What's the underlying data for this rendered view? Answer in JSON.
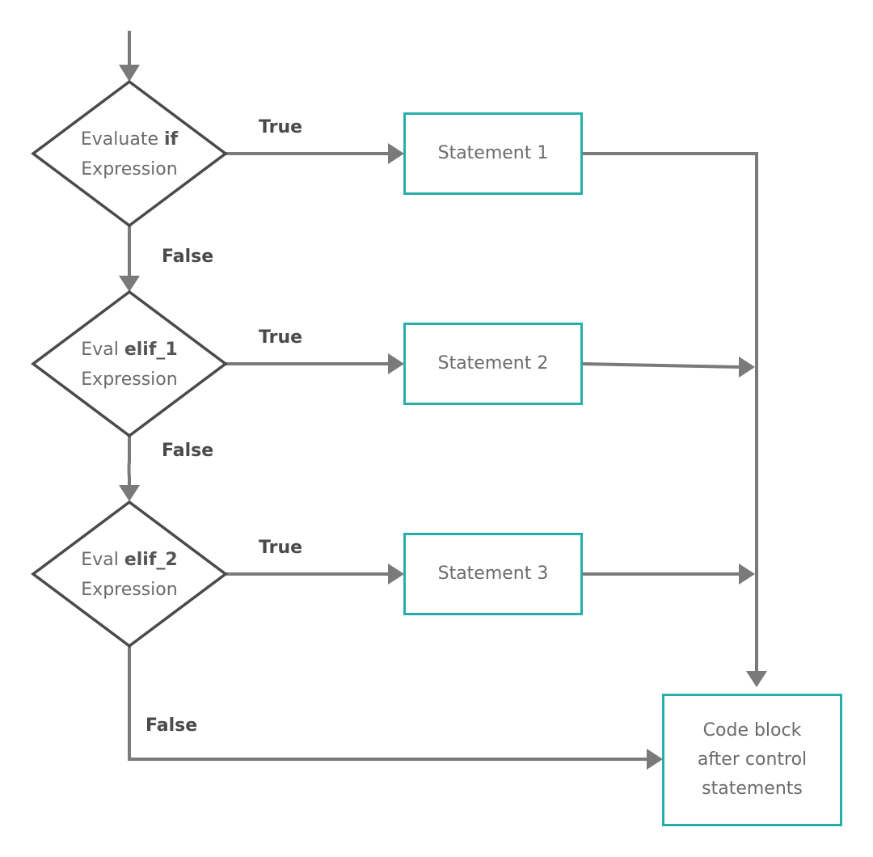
{
  "colors": {
    "edge": "#7a7a7a",
    "diamond_stroke": "#4a4a4a",
    "box_stroke": "#27aeac",
    "text": "#6b6b6b"
  },
  "nodes": {
    "if_decision": {
      "prefix": "Evaluate ",
      "keyword": "if",
      "line2": "Expression"
    },
    "elif1_decision": {
      "prefix": "Eval ",
      "keyword": "elif_1",
      "line2": "Expression"
    },
    "elif2_decision": {
      "prefix": "Eval ",
      "keyword": "elif_2",
      "line2": "Expression"
    },
    "statement1": "Statement 1",
    "statement2": "Statement 2",
    "statement3": "Statement 3",
    "after_block": {
      "line1": "Code block",
      "line2": "after control",
      "line3": "statements"
    }
  },
  "edge_labels": {
    "true1": "True",
    "true2": "True",
    "true3": "True",
    "false1": "False",
    "false2": "False",
    "false3": "False"
  }
}
